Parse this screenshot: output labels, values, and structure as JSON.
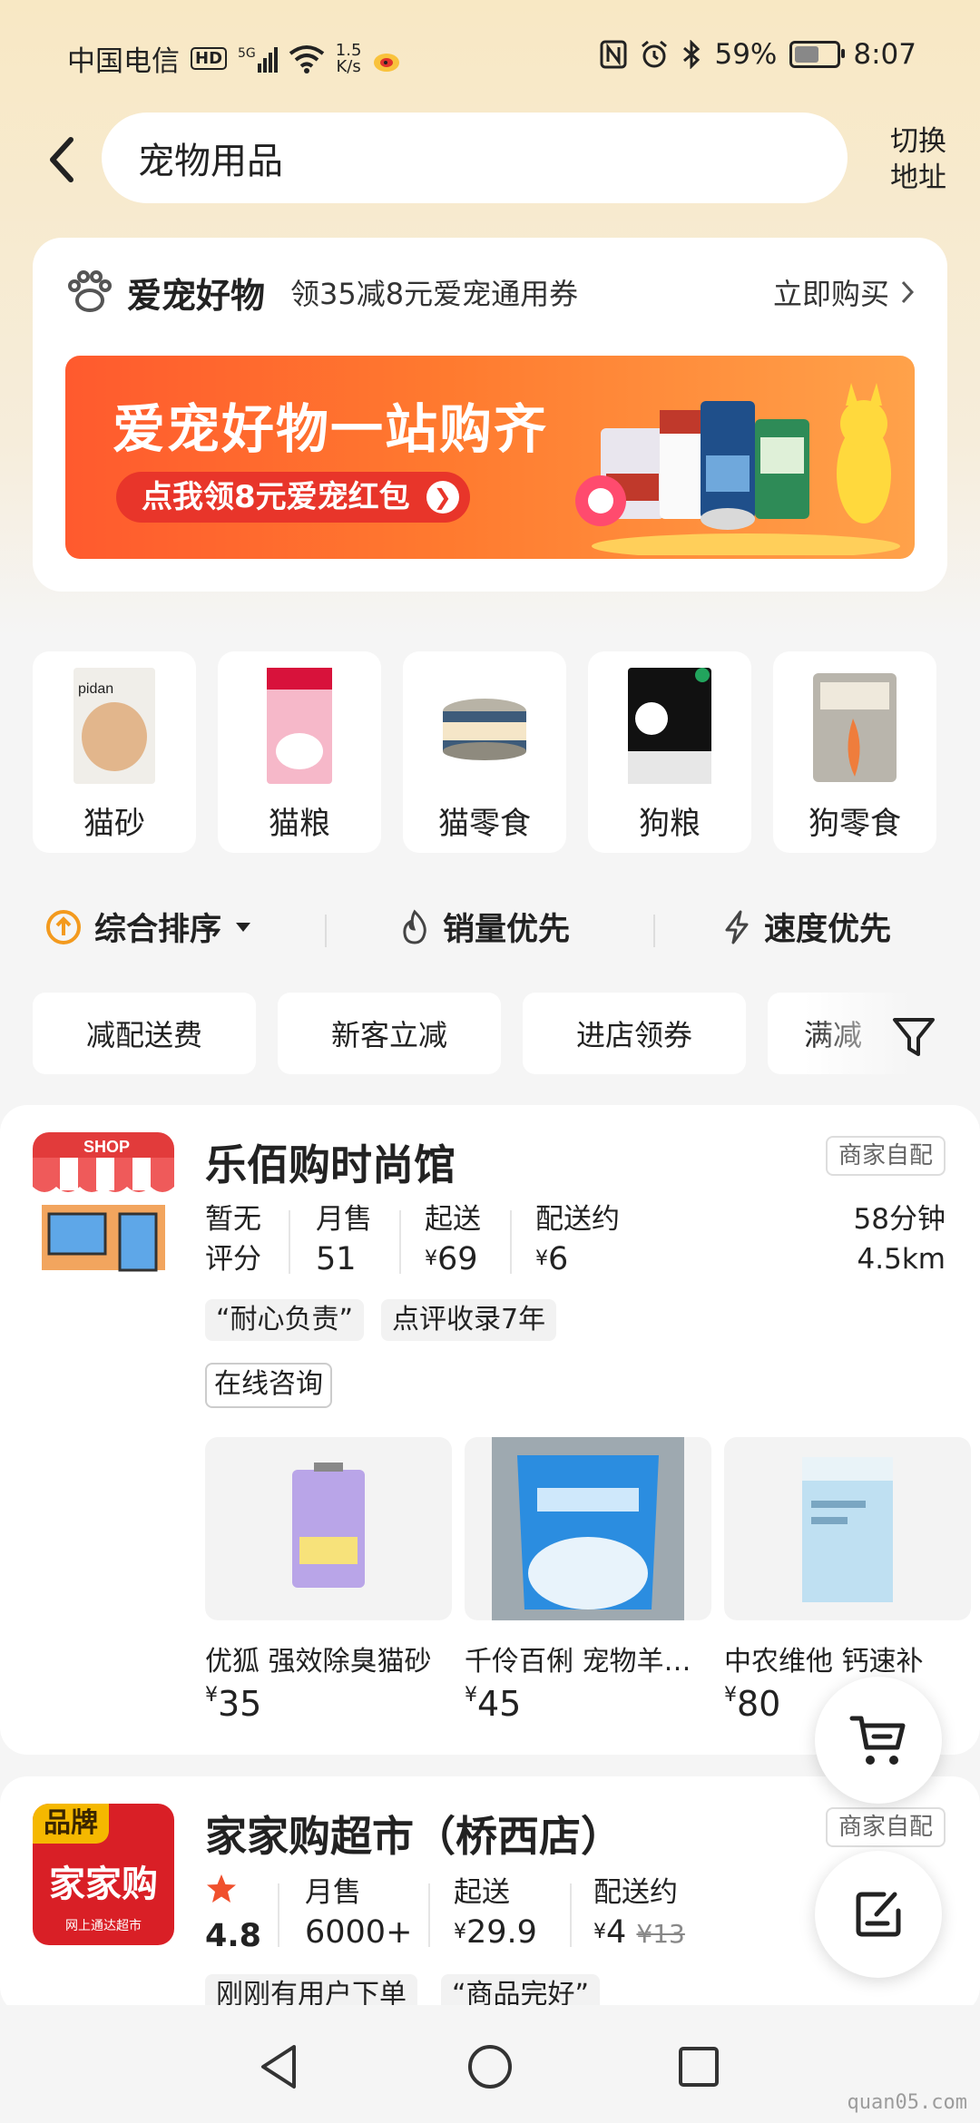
{
  "status_bar": {
    "carrier": "中国电信",
    "hd": "HD",
    "signal_label": "5G",
    "speed_value": "1.5",
    "speed_unit": "K/s",
    "battery": "59%",
    "battery_level": 0.59,
    "time": "8:07"
  },
  "search": {
    "query": "宠物用品",
    "switch_address": "切换\n地址"
  },
  "promo": {
    "title": "爱宠好物",
    "subtitle": "领35减8元爱宠通用券",
    "buy_now": "立即购买",
    "banner_title": "爱宠好物一站购齐",
    "banner_button": "点我领8元爱宠红包"
  },
  "categories": [
    {
      "label": "猫砂",
      "icon": "cat-litter-image"
    },
    {
      "label": "猫粮",
      "icon": "cat-food-image"
    },
    {
      "label": "猫零食",
      "icon": "cat-snack-image"
    },
    {
      "label": "狗粮",
      "icon": "dog-food-image"
    },
    {
      "label": "狗零食",
      "icon": "dog-snack-image"
    }
  ],
  "sort": {
    "composite": "综合排序",
    "sales": "销量优先",
    "speed": "速度优先"
  },
  "filters": [
    "减配送费",
    "新客立减",
    "进店领券",
    "满减"
  ],
  "stores": [
    {
      "name": "乐佰购时尚馆",
      "delivery_tag": "商家自配",
      "logo_text": "SHOP",
      "rating_label": "暂无\n评分",
      "monthly_sales_label": "月售",
      "monthly_sales": "51",
      "min_order_label": "起送",
      "min_order": "69",
      "delivery_fee_label": "配送约",
      "delivery_fee": "6",
      "eta": "58分钟",
      "distance": "4.5km",
      "tags": [
        "“耐心负责”",
        "点评收录7年"
      ],
      "consult": "在线咨询",
      "products": [
        {
          "name": "优狐 强效除臭猫砂",
          "price": "35"
        },
        {
          "name": "千伶百俐 宠物羊奶粉",
          "price": "45"
        },
        {
          "name": "中农维他 钙速补",
          "price": "80"
        }
      ]
    },
    {
      "name": "家家购超市（桥西店）",
      "delivery_tag": "商家自配",
      "logo_badge": "品牌",
      "logo_text": "家家购",
      "logo_sub": "网上通达超市",
      "rating": "4.8",
      "monthly_sales_label": "月售",
      "monthly_sales": "6000+",
      "min_order_label": "起送",
      "min_order": "29.9",
      "delivery_fee_label": "配送约",
      "delivery_fee": "4",
      "delivery_fee_original": "¥13",
      "tags": [
        "刚刚有用户下单",
        "“商品完好”"
      ]
    }
  ],
  "currency": "¥",
  "watermark": "quan05.com",
  "colors": {
    "accent": "#ff6a2e",
    "rating_star": "#f0502d",
    "logo_red": "#e02424"
  }
}
